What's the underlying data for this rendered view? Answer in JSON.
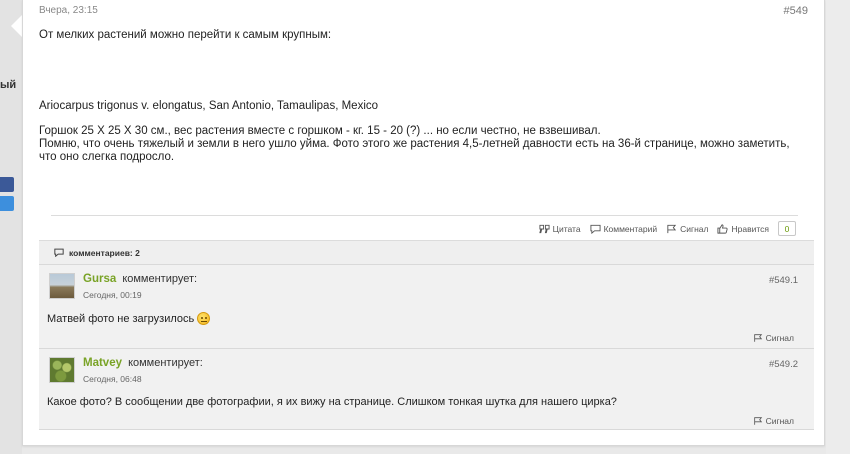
{
  "sidebar": {
    "cut_text": "ый"
  },
  "post": {
    "time": "Вчера, 23:15",
    "number": "#549",
    "lines": [
      "От мелких растений можно перейти к самым крупным:",
      "Ariocarpus trigonus v. elongatus, San Antonio, Tamaulipas, Mexico",
      "Горшок 25 X 25 X 30 см., вес растения вместе с горшком - кг. 15 - 20 (?) ... но если честно, не взвешивал.",
      "Помню, что очень тяжелый и земли в него ушло уйма. Фото этого же растения 4,5-летней давности есть на 36-й странице, можно заметить,",
      "что оно слегка подросло."
    ]
  },
  "actions": {
    "quote": "Цитата",
    "comment": "Комментарий",
    "signal": "Сигнал",
    "like": "Нравится",
    "like_count": "0"
  },
  "comments": {
    "header": "комментариев: 2",
    "verb": "комментирует:",
    "items": [
      {
        "author": "Gursa",
        "time": "Сегодня, 00:19",
        "number": "#549.1",
        "text": "Матвей фото не загрузилось",
        "signal": "Сигнал"
      },
      {
        "author": "Matvey",
        "time": "Сегодня, 06:48",
        "number": "#549.2",
        "text": "Какое фото? В сообщении две фотографии, я их вижу на странице. Слишком тонкая шутка для нашего цирка?",
        "signal": "Сигнал"
      }
    ]
  }
}
